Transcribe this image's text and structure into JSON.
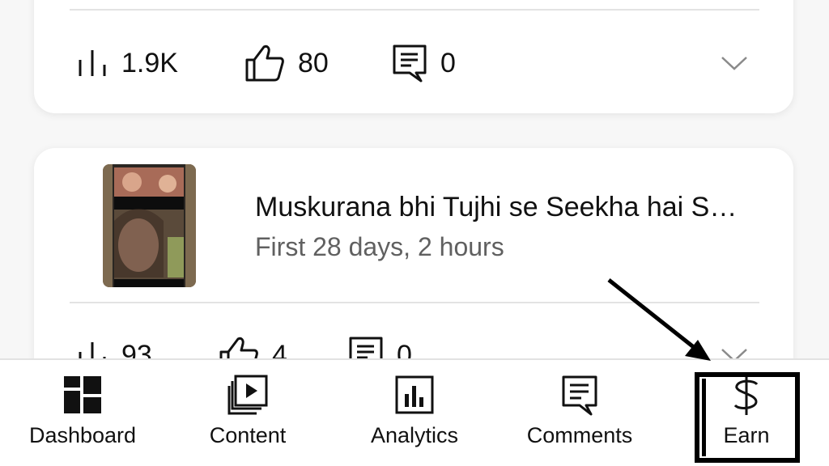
{
  "cards": [
    {
      "metrics": {
        "views": "1.9K",
        "likes": "80",
        "comments": "0"
      }
    },
    {
      "video_title": "Muskurana bhi Tujhi se Seekha hai S…",
      "video_subtitle": "First 28 days, 2 hours",
      "metrics": {
        "views": "93",
        "likes": "4",
        "comments": "0"
      }
    }
  ],
  "bottom_nav": {
    "items": [
      {
        "label": "Dashboard",
        "icon": "dashboard-icon"
      },
      {
        "label": "Content",
        "icon": "content-icon"
      },
      {
        "label": "Analytics",
        "icon": "analytics-icon"
      },
      {
        "label": "Comments",
        "icon": "comments-icon"
      },
      {
        "label": "Earn",
        "icon": "dollar-icon"
      }
    ],
    "highlighted": "Earn"
  },
  "colors": {
    "text": "#111111",
    "subtext": "#606060",
    "background": "#f7f7f7",
    "annotation": "#000000"
  }
}
